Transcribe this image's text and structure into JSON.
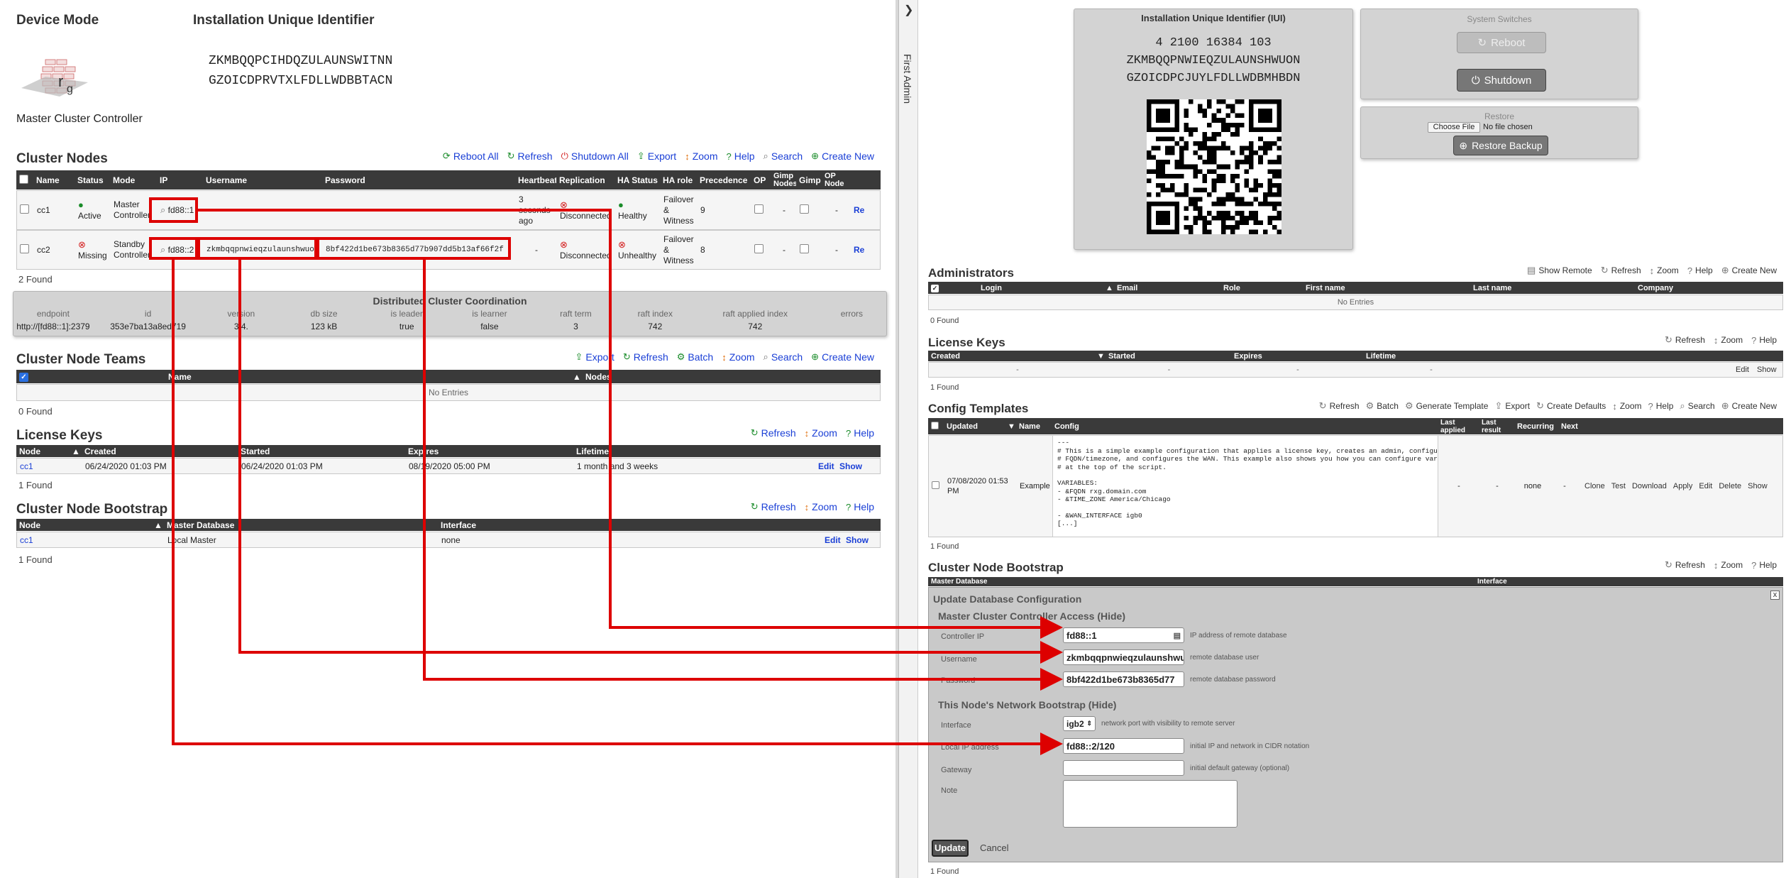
{
  "left": {
    "device_mode_title": "Device Mode",
    "device_mode_value": "Master Cluster Controller",
    "iui_title": "Installation Unique Identifier",
    "iui_lines": [
      "ZKMBQQPCIHDQZULAUNSWITNN",
      "GZOICDPRVTXLFDLLWDBBTACN"
    ],
    "cluster_nodes": {
      "title": "Cluster Nodes",
      "actions": [
        "Reboot All",
        "Refresh",
        "Shutdown All",
        "Export",
        "Zoom",
        "Help",
        "Search",
        "Create New"
      ],
      "headers": [
        "Name",
        "Status",
        "Mode",
        "IP",
        "Username",
        "Password",
        "Heartbeat",
        "Replication",
        "HA Status",
        "HA role",
        "Precedence",
        "OP",
        "Gimp Nodes",
        "Gimp",
        "OP Node"
      ],
      "rows": [
        {
          "name": "cc1",
          "status": "Active",
          "mode": "Master Controller",
          "ip": "fd88::1",
          "username": "",
          "password": "",
          "heartbeat": "3 seconds ago",
          "replication": "Disconnected",
          "ha_status": "Healthy",
          "ha_role": "Failover & Witness",
          "precedence": "9",
          "gimp_nodes": "-",
          "op_node": "-",
          "action": "Rebo"
        },
        {
          "name": "cc2",
          "status": "Missing",
          "mode": "Standby Controller",
          "ip": "fd88::2",
          "username": "zkmbqqpnwieqzulaunshwuon",
          "password": "8bf422d1be673b8365d77b907dd5b13af66f2f",
          "heartbeat": "-",
          "replication": "Disconnected",
          "ha_status": "Unhealthy",
          "ha_role": "Failover & Witness",
          "precedence": "8",
          "gimp_nodes": "-",
          "op_node": "-",
          "action": "Rebo"
        }
      ],
      "found": "2 Found"
    },
    "dcc": {
      "title": "Distributed Cluster Coordination",
      "headers": [
        "endpoint",
        "id",
        "version",
        "db size",
        "is leader",
        "is learner",
        "raft term",
        "raft index",
        "raft applied index",
        "errors"
      ],
      "values": [
        "http://[fd88::1]:2379",
        "353e7ba13a8ed719",
        "3.4.",
        "123 kB",
        "true",
        "false",
        "3",
        "742",
        "742",
        ""
      ]
    },
    "teams": {
      "title": "Cluster Node Teams",
      "actions": [
        "Export",
        "Refresh",
        "Batch",
        "Zoom",
        "Search",
        "Create New"
      ],
      "headers": [
        "Name",
        "Nodes"
      ],
      "empty": "No Entries",
      "found": "0 Found"
    },
    "license": {
      "title": "License Keys",
      "actions": [
        "Refresh",
        "Zoom",
        "Help"
      ],
      "headers": [
        "Node",
        "Created",
        "Started",
        "Expires",
        "Lifetime"
      ],
      "row": {
        "node": "cc1",
        "created": "06/24/2020 01:03 PM",
        "started": "06/24/2020 01:03 PM",
        "expires": "08/19/2020 05:00 PM",
        "lifetime": "1 month and 3 weeks",
        "edit": "Edit",
        "show": "Show"
      },
      "found": "1 Found"
    },
    "bootstrap": {
      "title": "Cluster Node Bootstrap",
      "actions": [
        "Refresh",
        "Zoom",
        "Help"
      ],
      "headers": [
        "Node",
        "Master Database",
        "Interface"
      ],
      "row": {
        "node": "cc1",
        "db": "Local Master",
        "iface": "none",
        "edit": "Edit",
        "show": "Show"
      },
      "found": "1 Found"
    }
  },
  "sidebar": {
    "label": "First Admin"
  },
  "right": {
    "iui_panel": {
      "title": "Installation Unique Identifier (IUI)",
      "lines": [
        "4 2100 16384 103",
        "ZKMBQQPNWIEQZULAUNSHWUON",
        "GZOICDPCJUYLFDLLWDBMHBDN"
      ]
    },
    "switches": {
      "title": "System Switches",
      "reboot": "Reboot",
      "shutdown": "Shutdown"
    },
    "restore": {
      "title": "Restore",
      "choose": "Choose File",
      "nofile": "No file chosen",
      "button": "Restore Backup"
    },
    "admins": {
      "title": "Administrators",
      "actions": [
        "Show Remote",
        "Refresh",
        "Zoom",
        "Help",
        "Create New"
      ],
      "headers": [
        "Login",
        "Email",
        "Role",
        "First name",
        "Last name",
        "Company"
      ],
      "empty": "No Entries",
      "found": "0 Found"
    },
    "license": {
      "title": "License Keys",
      "actions": [
        "Refresh",
        "Zoom",
        "Help"
      ],
      "headers": [
        "Created",
        "Started",
        "Expires",
        "Lifetime"
      ],
      "cells": [
        "-",
        "-",
        "-",
        "-"
      ],
      "edit": "Edit",
      "show": "Show",
      "found": "1 Found"
    },
    "templates": {
      "title": "Config Templates",
      "actions": [
        "Refresh",
        "Batch",
        "Generate Template",
        "Export",
        "Create Defaults",
        "Zoom",
        "Help",
        "Search",
        "Create New"
      ],
      "headers": [
        "Updated",
        "Name",
        "Config",
        "Last applied",
        "Last result",
        "Recurring",
        "Next"
      ],
      "row": {
        "updated": "07/08/2020 01:53 PM",
        "name": "Example",
        "config": [
          "---",
          "# This is a simple example configuration that applies a license key, creates an admin, configures",
          "# FQDN/timezone, and configures the WAN. This example also shows you how you can configure variables",
          "# at the top of the script.",
          "",
          "VARIABLES:",
          "- &FQDN rxg.domain.com",
          "- &TIME_ZONE America/Chicago",
          "",
          "- &WAN_INTERFACE igb0",
          "[...]"
        ],
        "last_applied": "-",
        "last_result": "-",
        "recurring": "none",
        "next": "-",
        "actions": [
          "Clone",
          "Test",
          "Download",
          "Apply",
          "Edit",
          "Delete",
          "Show"
        ]
      },
      "found": "1 Found"
    },
    "bootstrap": {
      "title": "Cluster Node Bootstrap",
      "actions": [
        "Refresh",
        "Zoom",
        "Help"
      ],
      "headers": [
        "Master Database",
        "Interface"
      ],
      "form": {
        "title": "Update Database Configuration",
        "close": "x",
        "access_title": "Master Cluster Controller Access (Hide)",
        "controller_ip_label": "Controller IP",
        "controller_ip": "fd88::1",
        "controller_ip_hint": "IP address of remote database",
        "username_label": "Username",
        "username": "zkmbqqpnwieqzulaunshwu",
        "username_hint": "remote database user",
        "password_label": "Password",
        "password": "8bf422d1be673b8365d77",
        "password_hint": "remote database password",
        "net_title": "This Node's Network Bootstrap (Hide)",
        "interface_label": "Interface",
        "interface": "igb2",
        "interface_hint": "network port with visibility to remote server",
        "local_ip_label": "Local IP address",
        "local_ip": "fd88::2/120",
        "local_ip_hint": "initial IP and network in CIDR notation",
        "gateway_label": "Gateway",
        "gateway": "",
        "gateway_hint": "initial default gateway (optional)",
        "note_label": "Note",
        "note": "",
        "update": "Update",
        "cancel": "Cancel"
      },
      "found": "1 Found"
    }
  },
  "colors": {
    "accent_link": "#1a3fd6",
    "annotation_red": "#dd0000",
    "header_dark": "#3a3a3a"
  }
}
